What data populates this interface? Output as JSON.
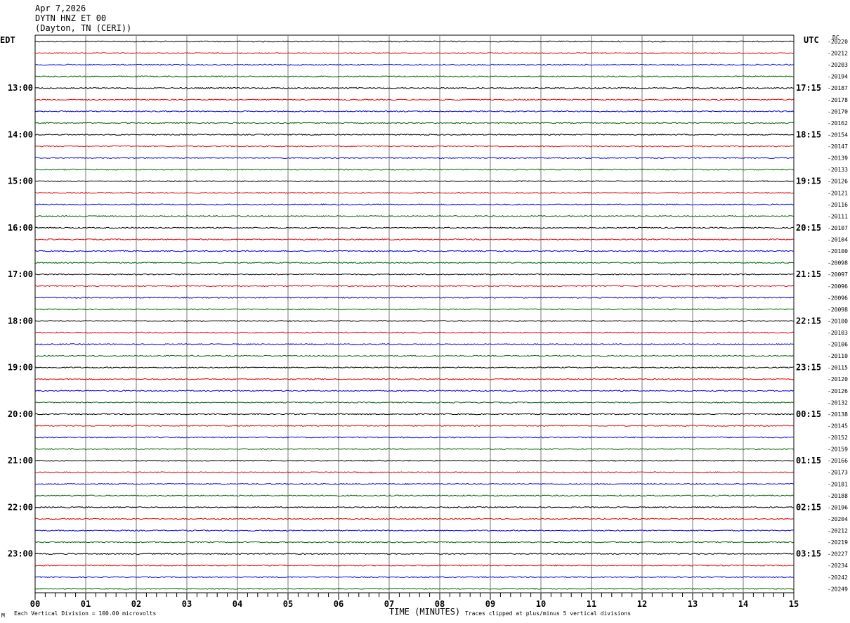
{
  "header": {
    "date": "Apr 7,2026",
    "station": "DYTN HNZ ET 00",
    "location": "(Dayton, TN (CERI))"
  },
  "left_timezone": "EDT",
  "right_timezone": "UTC",
  "dc_label": "DC",
  "footer": {
    "scale_note": "Each Vertical Division =  100.00 microvolts",
    "xlabel": "TIME (MINUTES)",
    "clip_note": "Traces clipped at plus/minus 5 vertical divisions",
    "corner_mark": "M"
  },
  "trace_colors": [
    "#000000",
    "#e00000",
    "#0000e0",
    "#006400"
  ],
  "chart_data": {
    "type": "line",
    "title": "DYTN HNZ ET 00",
    "xlabel": "TIME (MINUTES)",
    "xlim": [
      0,
      15
    ],
    "x_ticks": [
      "00",
      "01",
      "02",
      "03",
      "04",
      "05",
      "06",
      "07",
      "08",
      "09",
      "10",
      "11",
      "12",
      "13",
      "14",
      "15"
    ],
    "left_hour_labels": [
      "13:00",
      "14:00",
      "15:00",
      "16:00",
      "17:00",
      "18:00",
      "19:00",
      "20:00",
      "21:00",
      "22:00",
      "23:00"
    ],
    "right_hour_labels": [
      "17:15",
      "18:15",
      "19:15",
      "20:15",
      "21:15",
      "22:15",
      "23:15",
      "00:15",
      "01:15",
      "02:15",
      "03:15"
    ],
    "dc_offsets": [
      -20220,
      -20212,
      -20203,
      -20194,
      -20187,
      -20178,
      -20170,
      -20162,
      -20154,
      -20147,
      -20139,
      -20133,
      -20126,
      -20121,
      -20116,
      -20111,
      -20107,
      -20104,
      -20100,
      -20098,
      -20097,
      -20096,
      -20096,
      -20098,
      -20100,
      -20103,
      -20106,
      -20110,
      -20115,
      -20120,
      -20126,
      -20132,
      -20138,
      -20145,
      -20152,
      -20159,
      -20166,
      -20173,
      -20181,
      -20188,
      -20196,
      -20204,
      -20212,
      -20219,
      -20227,
      -20234,
      -20242,
      -20249
    ],
    "grid": true
  }
}
